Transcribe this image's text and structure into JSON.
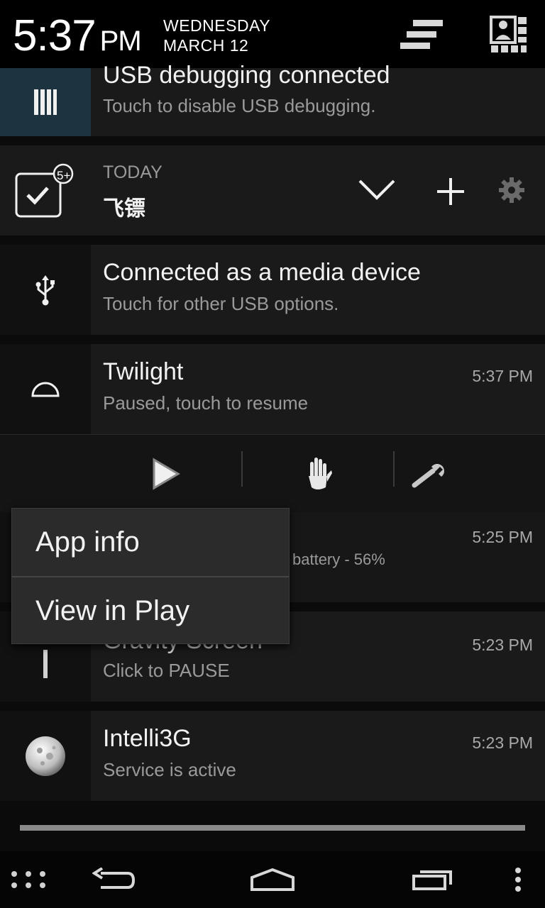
{
  "header": {
    "time": "5:37",
    "ampm": "PM",
    "weekday": "WEDNESDAY",
    "date": "MARCH 12"
  },
  "notifications": {
    "usb_debug": {
      "title": "USB debugging connected",
      "subtitle": "Touch to disable USB debugging."
    },
    "today": {
      "label": "TODAY",
      "title": "飞镖",
      "badge": "5+"
    },
    "media": {
      "title": "Connected as a media device",
      "subtitle": "Touch for other USB options."
    },
    "twilight": {
      "title": "Twilight",
      "subtitle": "Paused, touch to resume",
      "time": "5:37 PM"
    },
    "battery": {
      "subtitle_partial": "battery - 56%",
      "time": "5:25 PM"
    },
    "gravity": {
      "title": "Gravity Screen",
      "subtitle": "Click to PAUSE",
      "time": "5:23 PM"
    },
    "intelli": {
      "title": "Intelli3G",
      "subtitle": "Service is active",
      "time": "5:23 PM"
    }
  },
  "context_menu": {
    "items": [
      "App info",
      "View in Play"
    ]
  },
  "icons": {
    "clear_all": "clear-all-icon",
    "settings_profile": "quick-settings-icon",
    "usb": "usb-icon",
    "play": "play-icon",
    "hand": "hand-icon",
    "wrench": "wrench-icon"
  },
  "colors": {
    "background": "#000000",
    "notification_bg": "#1a1a1a",
    "usb_debug_icon_bg": "#1d3440",
    "subtitle": "#9a9a9a"
  }
}
